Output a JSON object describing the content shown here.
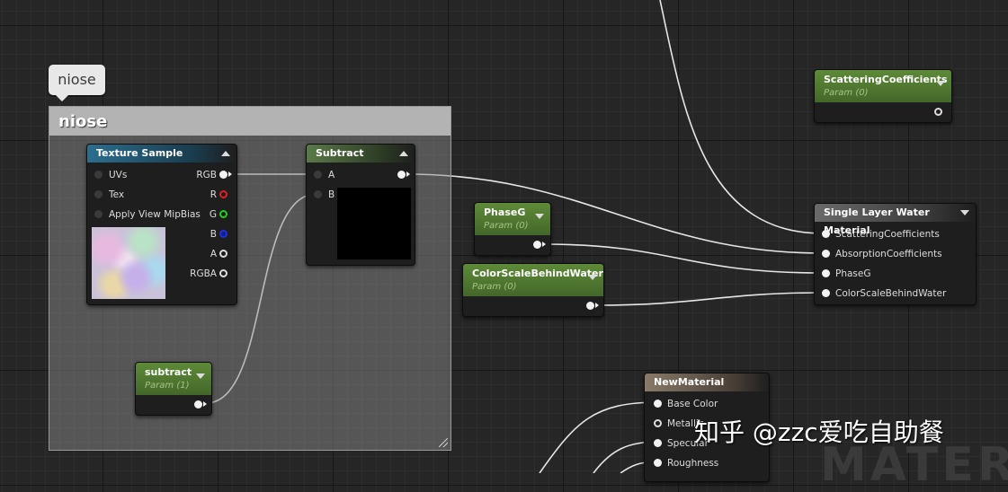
{
  "comment": {
    "tag_label": "niose",
    "title": "niose"
  },
  "texture_sample": {
    "title": "Texture Sample",
    "inputs": [
      "UVs",
      "Tex",
      "Apply View MipBias"
    ],
    "outputs": [
      "RGB",
      "R",
      "G",
      "B",
      "A",
      "RGBA"
    ]
  },
  "subtract_node": {
    "title": "Subtract",
    "inputs": [
      "A",
      "B"
    ]
  },
  "subtract_param": {
    "title": "subtract",
    "subtitle": "Param (1)"
  },
  "phaseg_param": {
    "title": "PhaseG",
    "subtitle": "Param (0)"
  },
  "colorscale_param": {
    "title": "ColorScaleBehindWater",
    "subtitle": "Param (0)"
  },
  "scattering_param": {
    "title": "ScatteringCoefficients",
    "subtitle": "Param (0)"
  },
  "water_node": {
    "title": "Single Layer Water Material",
    "inputs": [
      "ScatteringCoefficients",
      "AbsorptionCoefficients",
      "PhaseG",
      "ColorScaleBehindWater"
    ]
  },
  "new_material": {
    "title": "NewMaterial",
    "inputs": [
      "Base Color",
      "Metallic",
      "Specular",
      "Roughness"
    ]
  },
  "watermark": {
    "text": "知乎 @zzc爱吃自助餐"
  },
  "background_text": "MATER"
}
